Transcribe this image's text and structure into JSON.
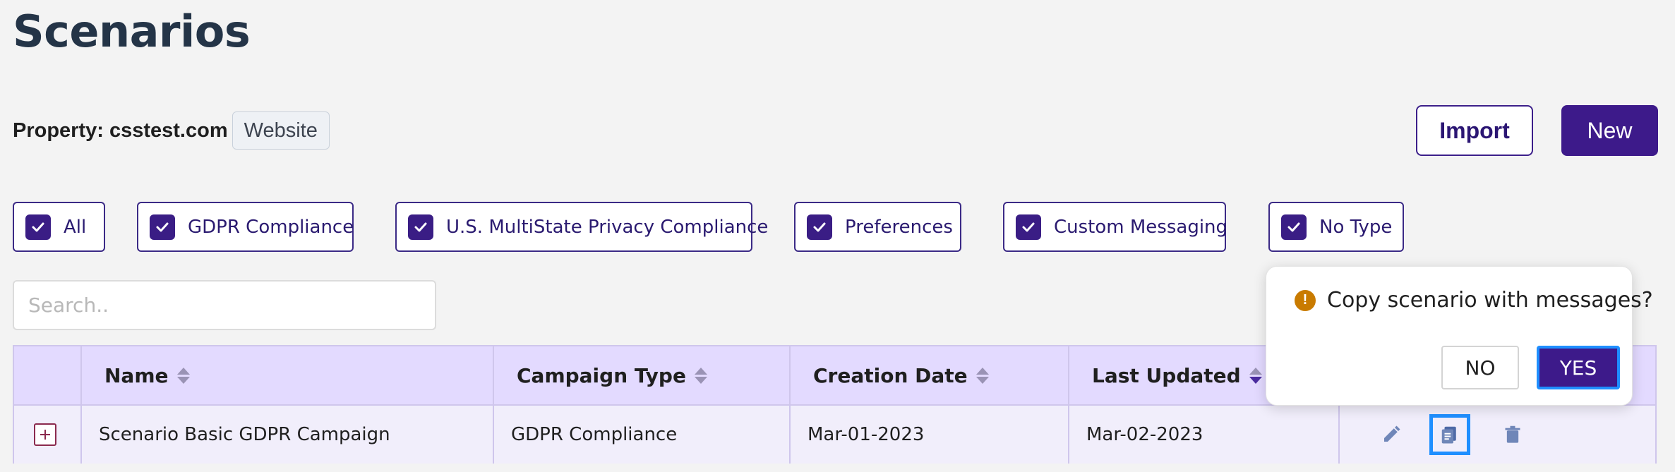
{
  "page": {
    "title": "Scenarios"
  },
  "property": {
    "label": "Property: csstest.com",
    "type_chip": "Website"
  },
  "toolbar": {
    "import_label": "Import",
    "new_label": "New"
  },
  "filters": [
    {
      "label": "All",
      "checked": true
    },
    {
      "label": "GDPR Compliance",
      "checked": true
    },
    {
      "label": "U.S. MultiState Privacy Compliance",
      "checked": true
    },
    {
      "label": "Preferences",
      "checked": true
    },
    {
      "label": "Custom Messaging",
      "checked": true
    },
    {
      "label": "No Type",
      "checked": true
    }
  ],
  "search": {
    "placeholder": "Search..",
    "value": ""
  },
  "table": {
    "columns": [
      "Name",
      "Campaign Type",
      "Creation Date",
      "Last Updated"
    ],
    "rows": [
      {
        "name": "Scenario Basic GDPR Campaign",
        "campaign_type": "GDPR Compliance",
        "creation_date": "Mar-01-2023",
        "last_updated": "Mar-02-2023"
      }
    ]
  },
  "popover": {
    "message": "Copy scenario with messages?",
    "no_label": "NO",
    "yes_label": "YES"
  },
  "icons": {
    "expand": "expand-plus-icon",
    "edit": "pencil-icon",
    "copy": "copy-icon",
    "delete": "trash-icon",
    "warning": "warning-icon"
  },
  "colors": {
    "brand": "#3d1a8a",
    "header_bg": "#e3daff",
    "focus_ring": "#1f8fff",
    "warning": "#c97b00"
  }
}
